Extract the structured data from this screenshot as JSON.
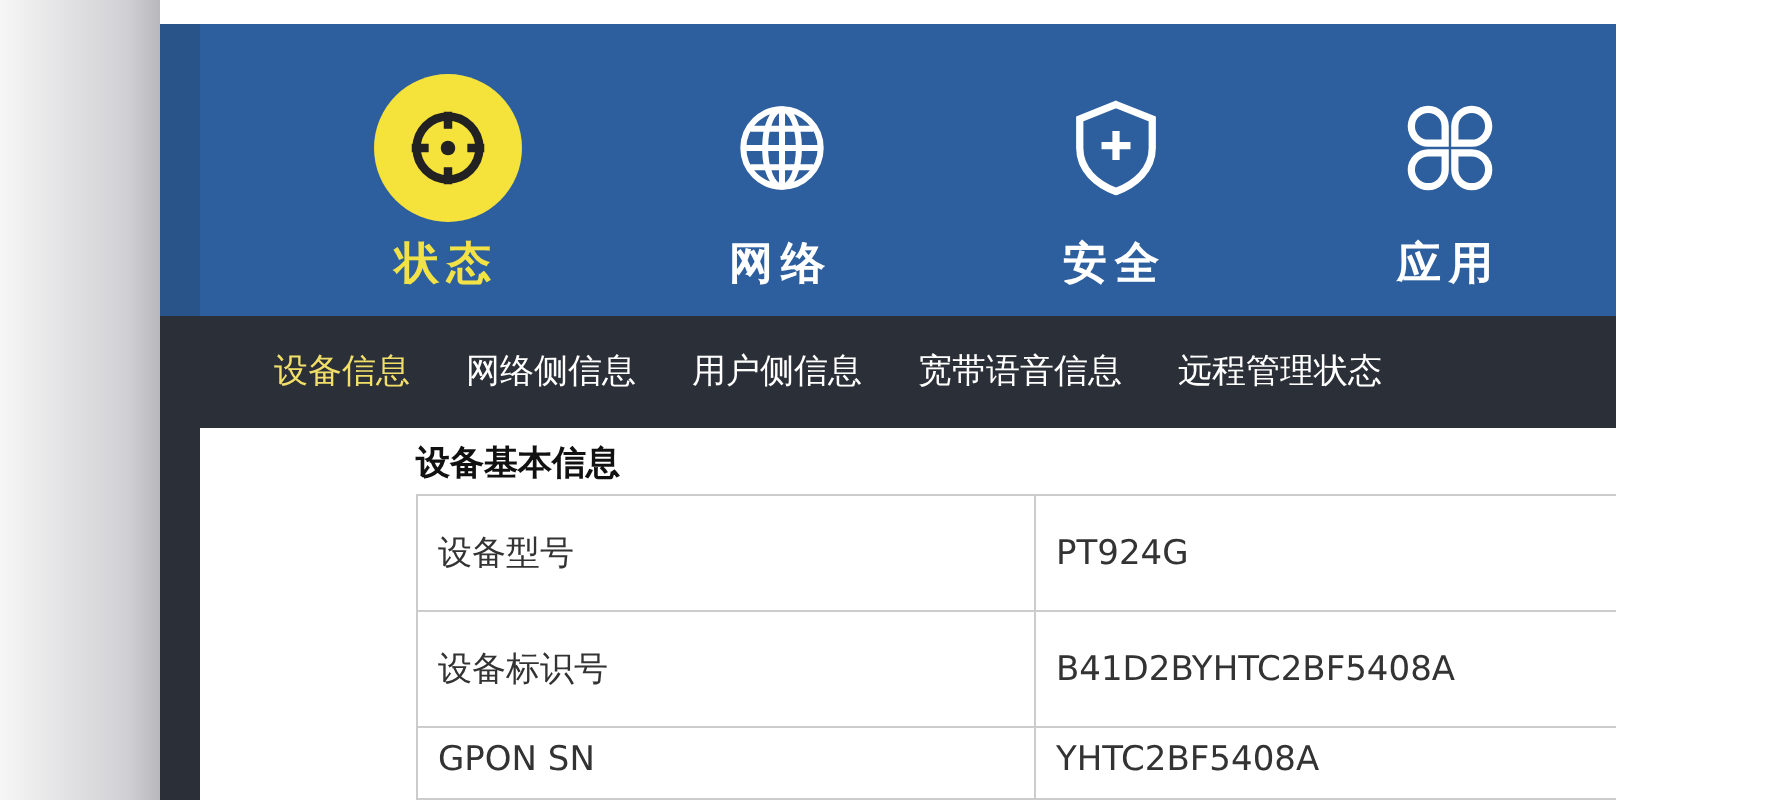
{
  "main_menu": [
    {
      "label": "状态",
      "kind": "status",
      "selected": true
    },
    {
      "label": "网络",
      "kind": "network",
      "selected": false
    },
    {
      "label": "安全",
      "kind": "security",
      "selected": false
    },
    {
      "label": "应用",
      "kind": "apps",
      "selected": false
    }
  ],
  "sub_menu": [
    {
      "label": "设备信息",
      "selected": true
    },
    {
      "label": "网络侧信息",
      "selected": false
    },
    {
      "label": "用户侧信息",
      "selected": false
    },
    {
      "label": "宽带语音信息",
      "selected": false
    },
    {
      "label": "远程管理状态",
      "selected": false
    }
  ],
  "section": {
    "title": "设备基本信息",
    "rows": [
      {
        "label": "设备型号",
        "value": "PT924G"
      },
      {
        "label": "设备标识号",
        "value": "B41D2BYHTC2BF5408A"
      },
      {
        "label": "GPON SN",
        "value": "YHTC2BF5408A"
      }
    ]
  }
}
